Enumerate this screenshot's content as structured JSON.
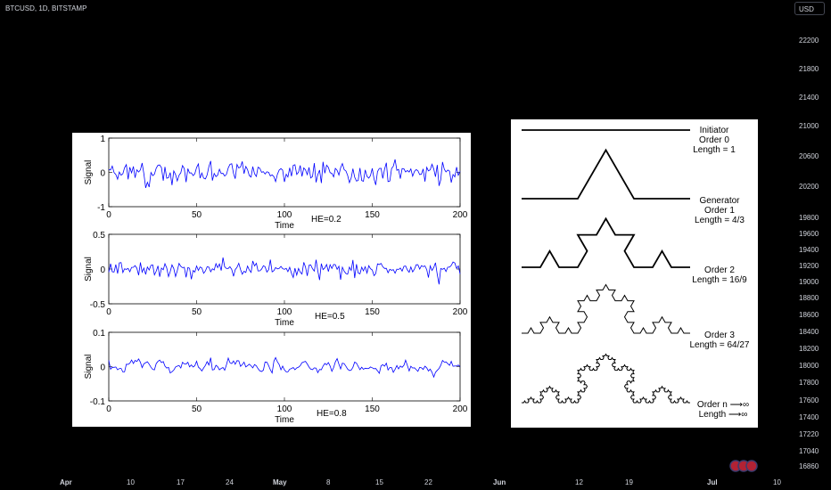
{
  "header": {
    "symbol": "BTCUSD, 1D, BITSTAMP",
    "currency": "USD"
  },
  "price_axis": [
    "22200",
    "21800",
    "21400",
    "21000",
    "20600",
    "20200",
    "19800",
    "19600",
    "19400",
    "19200",
    "19000",
    "18800",
    "18600",
    "18400",
    "18200",
    "18000",
    "17800",
    "17600",
    "17400",
    "17220",
    "17040",
    "16860"
  ],
  "time_axis": [
    {
      "label": "Apr",
      "bold": true
    },
    {
      "label": "10",
      "bold": false
    },
    {
      "label": "17",
      "bold": false
    },
    {
      "label": "24",
      "bold": false
    },
    {
      "label": "May",
      "bold": true
    },
    {
      "label": "8",
      "bold": false
    },
    {
      "label": "15",
      "bold": false
    },
    {
      "label": "22",
      "bold": false
    },
    {
      "label": "Jun",
      "bold": true
    },
    {
      "label": "12",
      "bold": false
    },
    {
      "label": "19",
      "bold": false
    },
    {
      "label": "Jul",
      "bold": true
    },
    {
      "label": "10",
      "bold": false
    }
  ],
  "chart_data": [
    {
      "type": "line",
      "series": [
        {
          "color": "#0000ff"
        }
      ],
      "ylabel": "Signal",
      "xlabel": "Time",
      "annotation": "HE=0.2",
      "ylim": [
        -1,
        1
      ],
      "xlim": [
        0,
        200
      ],
      "yticks": [
        "1",
        "0",
        "-1"
      ],
      "xticks": [
        "0",
        "50",
        "100",
        "150",
        "200"
      ]
    },
    {
      "type": "line",
      "series": [
        {
          "color": "#0000ff"
        }
      ],
      "ylabel": "Signal",
      "xlabel": "Time",
      "annotation": "HE=0.5",
      "ylim": [
        -0.5,
        0.5
      ],
      "xlim": [
        0,
        200
      ],
      "yticks": [
        "0.5",
        "0",
        "-0.5"
      ],
      "xticks": [
        "0",
        "50",
        "100",
        "150",
        "200"
      ]
    },
    {
      "type": "line",
      "series": [
        {
          "color": "#0000ff"
        }
      ],
      "ylabel": "Signal",
      "xlabel": "Time",
      "annotation": "HE=0.8",
      "ylim": [
        -0.1,
        0.1
      ],
      "xlim": [
        0,
        200
      ],
      "yticks": [
        "0.1",
        "0",
        "-0.1"
      ],
      "xticks": [
        "0",
        "50",
        "100",
        "150",
        "200"
      ]
    }
  ],
  "koch": [
    {
      "order": 0,
      "lines": [
        "Initiator",
        "Order 0",
        "Length = 1"
      ]
    },
    {
      "order": 1,
      "lines": [
        "Generator",
        "Order 1",
        "Length = 4/3"
      ]
    },
    {
      "order": 2,
      "lines": [
        "Order 2",
        "Length = 16/9"
      ]
    },
    {
      "order": 3,
      "lines": [
        "Order 3",
        "Length = 64/27"
      ]
    },
    {
      "order": "n",
      "lines": [
        "Order n ⟶∞",
        "Length ⟶∞"
      ]
    }
  ]
}
